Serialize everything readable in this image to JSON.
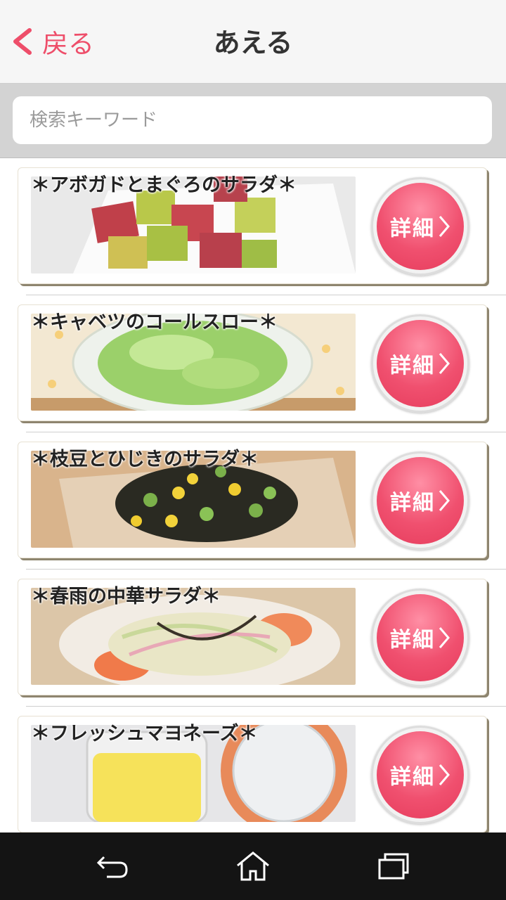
{
  "header": {
    "back_label": "戻る",
    "title": "あえる"
  },
  "search": {
    "placeholder": "検索キーワード",
    "value": ""
  },
  "detail_label": "詳細",
  "recipes": [
    {
      "title": "＊アボガドとまぐろのサラダ＊",
      "photo": "avocado-tuna-salad"
    },
    {
      "title": "＊キャベツのコールスロー＊",
      "photo": "cabbage-coleslaw"
    },
    {
      "title": "＊枝豆とひじきのサラダ＊",
      "photo": "edamame-hijiki-salad"
    },
    {
      "title": "＊春雨の中華サラダ＊",
      "photo": "harusame-chinese-salad"
    },
    {
      "title": "＊フレッシュマヨネーズ＊",
      "photo": "fresh-mayonnaise"
    }
  ],
  "colors": {
    "accent": "#ee4e6a",
    "button": "#f0506f",
    "navbar": "#141414"
  },
  "icons": [
    "back-chevron-icon",
    "back-nav-icon",
    "home-nav-icon",
    "recent-apps-icon"
  ]
}
